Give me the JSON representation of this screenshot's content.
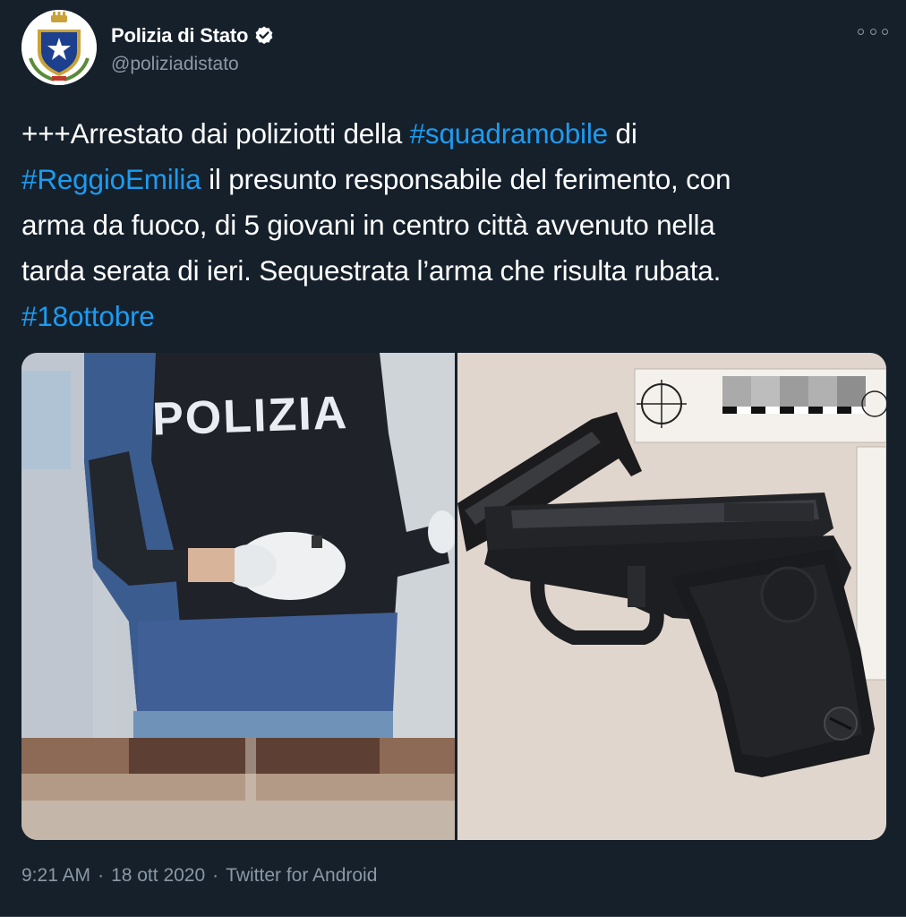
{
  "author": {
    "display_name": "Polizia di Stato",
    "handle": "@poliziadistato",
    "verified": true,
    "avatar_icon": "police-emblem-icon"
  },
  "tweet": {
    "lines": [
      [
        {
          "t": "+++Arrestato dai poliziotti della ",
          "h": false
        },
        {
          "t": "#squadramobile",
          "h": true
        },
        {
          "t": " di",
          "h": false
        }
      ],
      [
        {
          "t": "#ReggioEmilia",
          "h": true
        },
        {
          "t": " il presunto responsabile del ferimento, con",
          "h": false
        }
      ],
      [
        {
          "t": "arma da fuoco, di 5 giovani in centro città avvenuto nella",
          "h": false
        }
      ],
      [
        {
          "t": "tarda serata di ieri. Sequestrata l’arma che risulta rubata.",
          "h": false
        }
      ],
      [
        {
          "t": "#18ottobre",
          "h": true
        }
      ]
    ]
  },
  "media": {
    "left_photo_text": "POLIZIA",
    "left_photo_icon": "officer-photo",
    "right_photo_icon": "pistol-photo"
  },
  "meta": {
    "time": "9:21 AM",
    "date": "18 ott 2020",
    "source": "Twitter for Android",
    "separator": "·"
  },
  "colors": {
    "background": "#15202b",
    "link": "#1d9bf0",
    "secondary_text": "#8b98a5"
  }
}
